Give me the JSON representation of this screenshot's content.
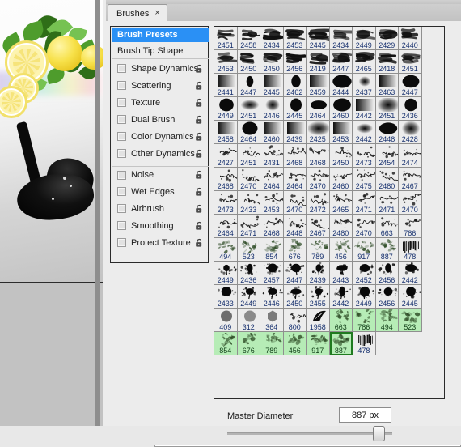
{
  "window": {
    "tab_label": "Brushes",
    "tab_close": "×"
  },
  "options_panel": {
    "preset_label": "Brush Presets",
    "tip_shape_label": "Brush Tip Shape",
    "items": [
      {
        "label": "Shape Dynamics",
        "checked": false,
        "lock": "lock-icon"
      },
      {
        "label": "Scattering",
        "checked": false,
        "lock": "lock-icon"
      },
      {
        "label": "Texture",
        "checked": false,
        "lock": "lock-icon"
      },
      {
        "label": "Dual Brush",
        "checked": false,
        "lock": "lock-icon"
      },
      {
        "label": "Color Dynamics",
        "checked": false,
        "lock": "lock-icon"
      },
      {
        "label": "Other Dynamics",
        "checked": false,
        "lock": "lock-icon"
      },
      {
        "label": "Noise",
        "checked": false,
        "lock": "lock-icon"
      },
      {
        "label": "Wet Edges",
        "checked": false,
        "lock": "lock-icon"
      },
      {
        "label": "Airbrush",
        "checked": false,
        "lock": "lock-icon"
      },
      {
        "label": "Smoothing",
        "checked": false,
        "lock": "lock-icon"
      },
      {
        "label": "Protect Texture",
        "checked": false,
        "lock": "lock-icon"
      }
    ]
  },
  "brush_grid": {
    "columns": 10,
    "rows": [
      [
        "2451",
        "2458",
        "2434",
        "2453",
        "2445",
        "2434",
        "2449",
        "2429",
        "2440",
        ""
      ],
      [
        "2453",
        "2450",
        "2450",
        "2456",
        "2419",
        "2447",
        "2465",
        "2418",
        "2451",
        ""
      ],
      [
        "2441",
        "2447",
        "2445",
        "2462",
        "2459",
        "2444",
        "2437",
        "2463",
        "2447",
        ""
      ],
      [
        "2449",
        "2451",
        "2446",
        "2445",
        "2464",
        "2460",
        "2442",
        "2451",
        "2436",
        ""
      ],
      [
        "2458",
        "2464",
        "2460",
        "2439",
        "2425",
        "2453",
        "2442",
        "2448",
        "2428",
        ""
      ],
      [
        "2427",
        "2451",
        "2431",
        "2468",
        "2468",
        "2450",
        "2473",
        "2454",
        "2474",
        ""
      ],
      [
        "2468",
        "2470",
        "2464",
        "2464",
        "2470",
        "2460",
        "2475",
        "2480",
        "2467",
        ""
      ],
      [
        "2473",
        "2433",
        "2453",
        "2470",
        "2472",
        "2465",
        "2471",
        "2471",
        "2470",
        ""
      ],
      [
        "2464",
        "2471",
        "2468",
        "2448",
        "2467",
        "2480",
        "2470",
        "663",
        "786",
        ""
      ],
      [
        "494",
        "523",
        "854",
        "676",
        "789",
        "456",
        "917",
        "887",
        "478",
        ""
      ],
      [
        "2449",
        "2436",
        "2457",
        "2447",
        "2439",
        "2443",
        "2452",
        "2456",
        "2442",
        ""
      ],
      [
        "2433",
        "2449",
        "2446",
        "2450",
        "2455",
        "2442",
        "2449",
        "2456",
        "2445",
        ""
      ],
      [
        "409",
        "312",
        "364",
        "800",
        "1958",
        "663",
        "786",
        "494",
        "523",
        ""
      ],
      [
        "854",
        "676",
        "789",
        "456",
        "917",
        "887",
        "478",
        "",
        ""
      ]
    ],
    "selected": [
      "663",
      "786",
      "494",
      "523",
      "854",
      "676",
      "789",
      "456",
      "917",
      "887"
    ],
    "active": "887"
  },
  "master_diameter": {
    "label": "Master Diameter",
    "value": "887 px",
    "slider_percent": 88
  },
  "colors": {
    "accent": "#2a90f5",
    "selection_green": "#b6ecb6",
    "active_outline": "#1f7a1f",
    "number_blue": "#16306e",
    "panel_bg": "#ececec"
  }
}
